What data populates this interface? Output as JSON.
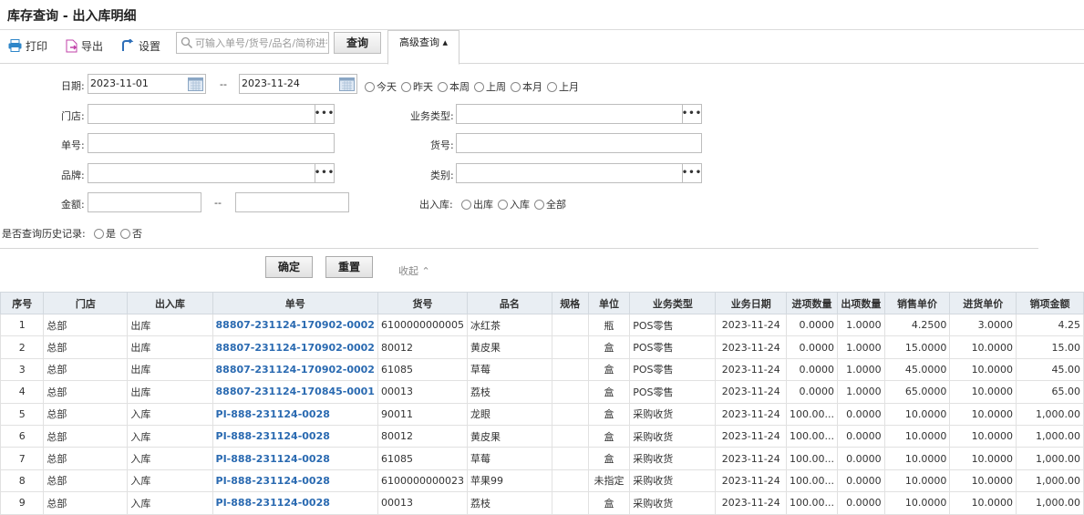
{
  "window": {
    "title": "库存查询 - 出入库明细"
  },
  "toolbar": {
    "print_label": "打印",
    "export_label": "导出",
    "settings_label": "设置",
    "search_placeholder": "可输入单号/货号/品名/简称进行",
    "query_label": "查询",
    "advanced_label": "高级查询 ▴"
  },
  "filters": {
    "date_label": "日期:",
    "date_from": "2023-11-01",
    "date_sep": "--",
    "date_to": "2023-11-24",
    "date_ranges": [
      "今天",
      "昨天",
      "本周",
      "上周",
      "本月",
      "上月"
    ],
    "store_label": "门店:",
    "store_value": "",
    "biz_type_label": "业务类型:",
    "biz_type_value": "",
    "doc_no_label": "单号:",
    "doc_no_value": "",
    "item_no_label": "货号:",
    "item_no_value": "",
    "brand_label": "品牌:",
    "brand_value": "",
    "category_label": "类别:",
    "category_value": "",
    "amount_label": "金额:",
    "amount_from": "",
    "amount_sep": "--",
    "amount_to": "",
    "inout_label": "出入库:",
    "inout_options": [
      "出库",
      "入库",
      "全部"
    ],
    "history_label": "是否查询历史记录:",
    "history_options": [
      "是",
      "否"
    ]
  },
  "actions": {
    "confirm": "确定",
    "reset": "重置",
    "collapse": "收起 ⌃"
  },
  "table": {
    "headers": [
      "序号",
      "门店",
      "出入库",
      "单号",
      "货号",
      "品名",
      "规格",
      "单位",
      "业务类型",
      "业务日期",
      "进项数量",
      "出项数量",
      "销售单价",
      "进货单价",
      "销项金额"
    ],
    "rows": [
      [
        "1",
        "总部",
        "出库",
        "88807-231124-170902-0002",
        "6100000000005",
        "冰红茶",
        "",
        "瓶",
        "POS零售",
        "2023-11-24",
        "0.0000",
        "1.0000",
        "4.2500",
        "3.0000",
        "4.25"
      ],
      [
        "2",
        "总部",
        "出库",
        "88807-231124-170902-0002",
        "80012",
        "黄皮果",
        "",
        "盒",
        "POS零售",
        "2023-11-24",
        "0.0000",
        "1.0000",
        "15.0000",
        "10.0000",
        "15.00"
      ],
      [
        "3",
        "总部",
        "出库",
        "88807-231124-170902-0002",
        "61085",
        "草莓",
        "",
        "盒",
        "POS零售",
        "2023-11-24",
        "0.0000",
        "1.0000",
        "45.0000",
        "10.0000",
        "45.00"
      ],
      [
        "4",
        "总部",
        "出库",
        "88807-231124-170845-0001",
        "00013",
        "荔枝",
        "",
        "盒",
        "POS零售",
        "2023-11-24",
        "0.0000",
        "1.0000",
        "65.0000",
        "10.0000",
        "65.00"
      ],
      [
        "5",
        "总部",
        "入库",
        "PI-888-231124-0028",
        "90011",
        "龙眼",
        "",
        "盒",
        "采购收货",
        "2023-11-24",
        "100.00...",
        "0.0000",
        "10.0000",
        "10.0000",
        "1,000.00"
      ],
      [
        "6",
        "总部",
        "入库",
        "PI-888-231124-0028",
        "80012",
        "黄皮果",
        "",
        "盒",
        "采购收货",
        "2023-11-24",
        "100.00...",
        "0.0000",
        "10.0000",
        "10.0000",
        "1,000.00"
      ],
      [
        "7",
        "总部",
        "入库",
        "PI-888-231124-0028",
        "61085",
        "草莓",
        "",
        "盒",
        "采购收货",
        "2023-11-24",
        "100.00...",
        "0.0000",
        "10.0000",
        "10.0000",
        "1,000.00"
      ],
      [
        "8",
        "总部",
        "入库",
        "PI-888-231124-0028",
        "6100000000023",
        "苹果99",
        "",
        "未指定",
        "采购收货",
        "2023-11-24",
        "100.00...",
        "0.0000",
        "10.0000",
        "10.0000",
        "1,000.00"
      ],
      [
        "9",
        "总部",
        "入库",
        "PI-888-231124-0028",
        "00013",
        "荔枝",
        "",
        "盒",
        "采购收货",
        "2023-11-24",
        "100.00...",
        "0.0000",
        "10.0000",
        "10.0000",
        "1,000.00"
      ]
    ]
  }
}
